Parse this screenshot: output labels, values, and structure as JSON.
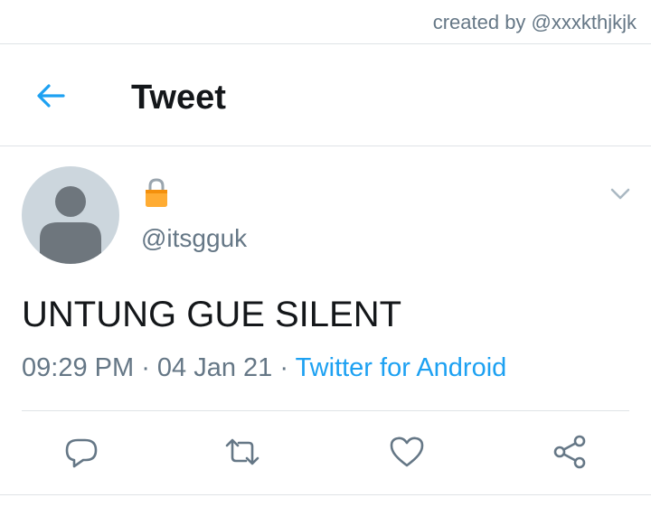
{
  "watermark": "created by @xxxkthjkjk",
  "header": {
    "title": "Tweet",
    "back_icon": "arrow-left-icon"
  },
  "tweet": {
    "display_name": "",
    "protected_icon": "lock-icon",
    "handle": "@itsgguk",
    "text": "UNTUNG GUE SILENT",
    "time": "09:29 PM",
    "separator1": " · ",
    "date": "04 Jan 21",
    "separator2": " · ",
    "source": "Twitter for Android"
  },
  "actions": {
    "icons": [
      "reply-icon",
      "retweet-icon",
      "like-icon",
      "share-icon"
    ]
  },
  "colors": {
    "accent": "#1da1f2",
    "text_primary": "#14171a",
    "text_secondary": "#657786",
    "divider": "#dfe3e6",
    "avatar_bg": "#ccd6dd",
    "avatar_fg": "#6e767d",
    "lock": "#ffac33"
  }
}
